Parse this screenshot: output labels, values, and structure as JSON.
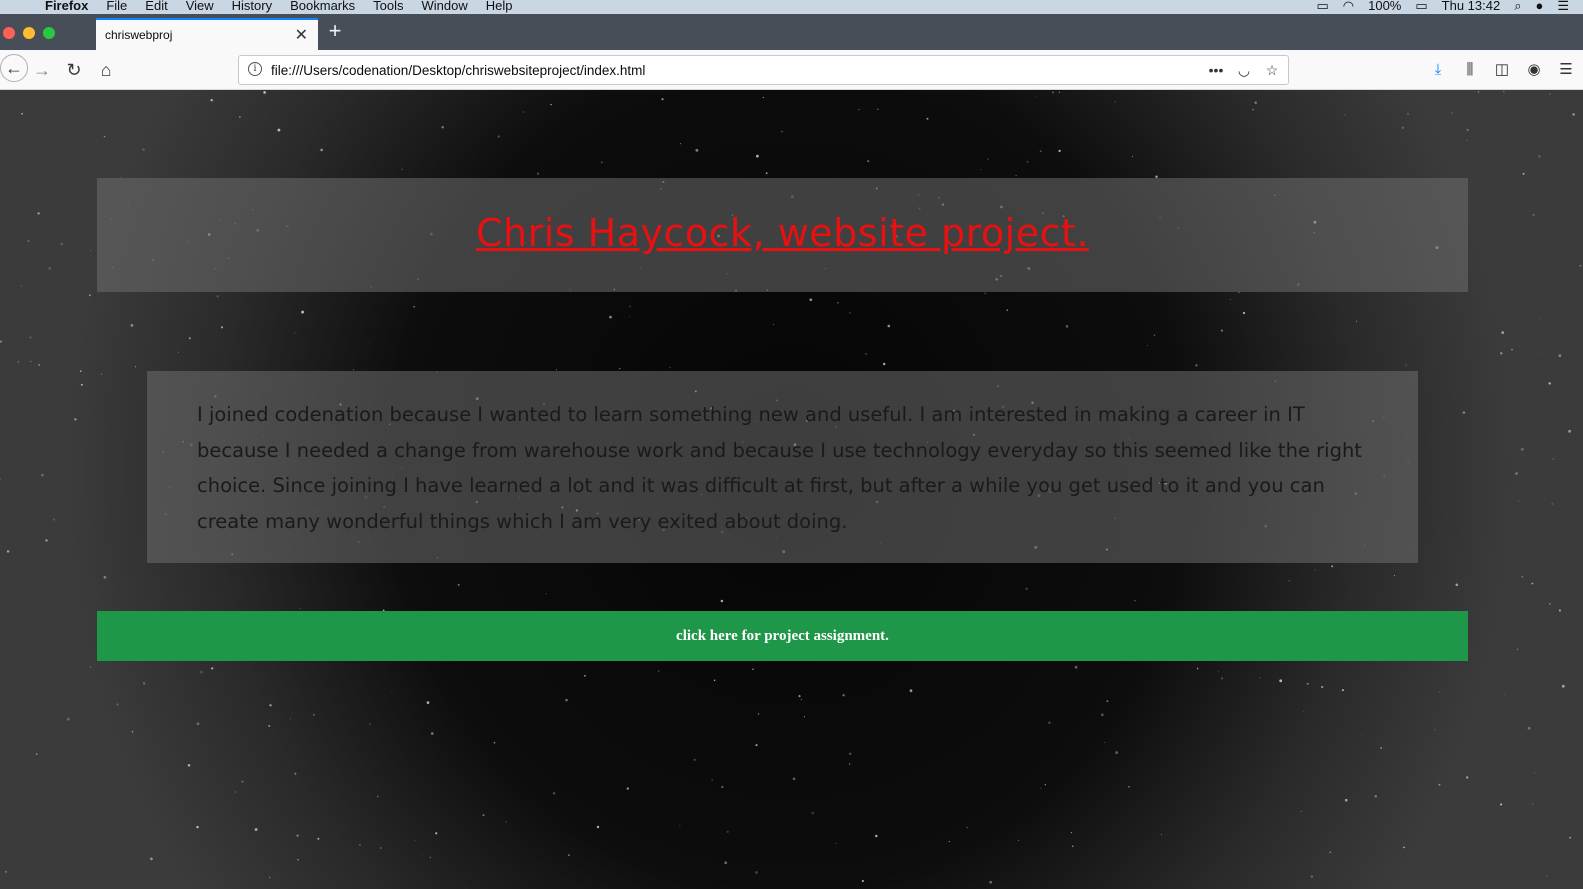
{
  "menubar": {
    "app_name": "Firefox",
    "items": [
      "File",
      "Edit",
      "View",
      "History",
      "Bookmarks",
      "Tools",
      "Window",
      "Help"
    ],
    "battery": "100%",
    "clock": "Thu 13:42"
  },
  "browser": {
    "tab_title": "chriswebproj",
    "url": "file:///Users/codenation/Desktop/chriswebsiteproject/index.html",
    "accent_color": "#0a84ff"
  },
  "page": {
    "title": "Chris Haycock, website project.",
    "about": "I joined codenation because I wanted to learn something new and useful. I am interested in making a career in IT because I needed a change from warehouse work and because I use technology everyday so this seemed like the right choice. Since joining I have learned a lot and it was difficult at first, but after a while you get used to it and you can create many wonderful things which I am very exited about doing.",
    "button_label": "click here for project assignment.",
    "title_color": "#e81010",
    "button_color": "#1f9748"
  }
}
